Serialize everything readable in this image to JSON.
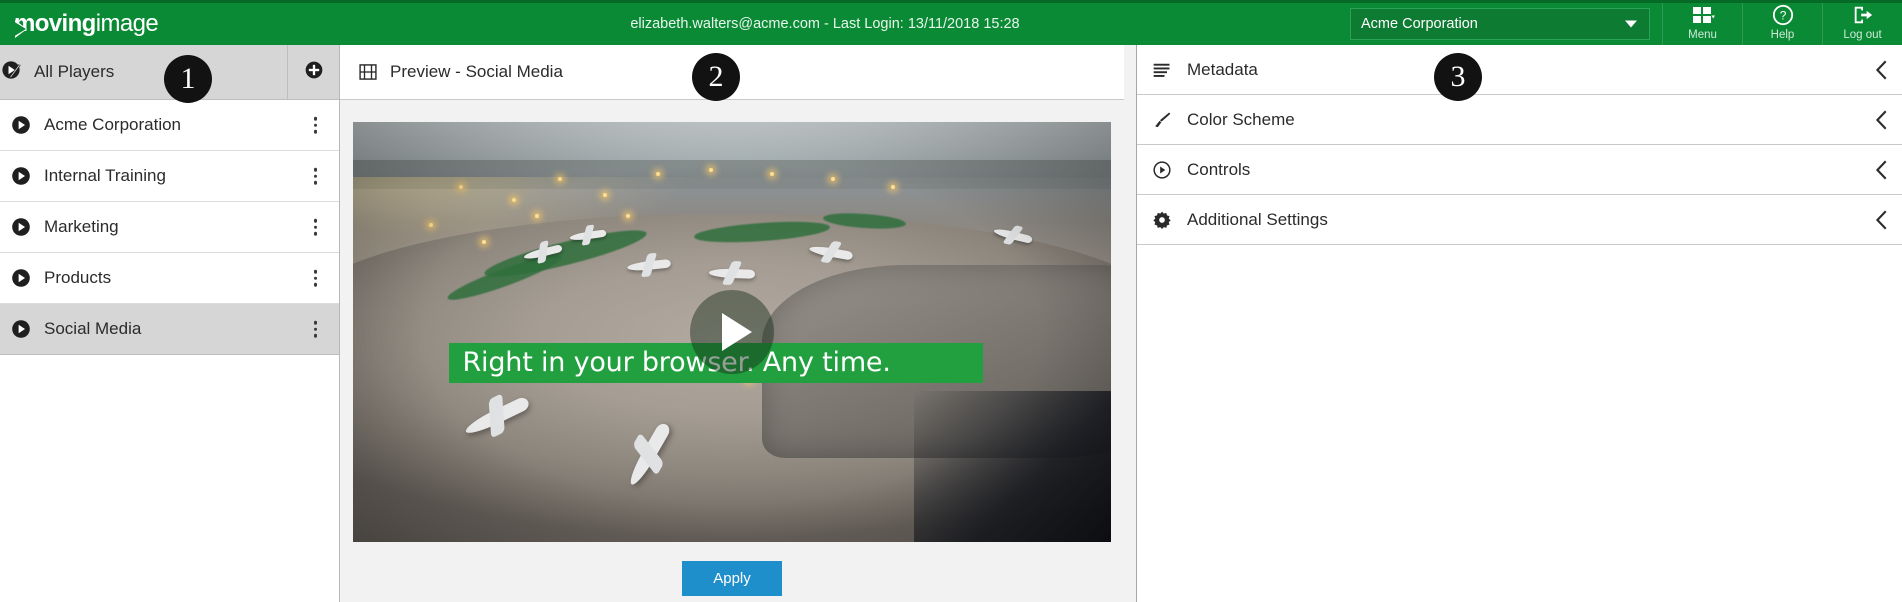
{
  "header": {
    "brand_bold": "moving",
    "brand_thin": "image",
    "session": "elizabeth.walters@acme.com - Last Login: 13/11/2018 15:28",
    "org_selected": "Acme Corporation",
    "actions": [
      {
        "label": "Menu",
        "icon": "grid-menu-icon"
      },
      {
        "label": "Help",
        "icon": "question-circle-icon"
      },
      {
        "label": "Log out",
        "icon": "logout-icon"
      }
    ],
    "colors": {
      "brand_green": "#0b8a36",
      "top_rule": "#046a26"
    }
  },
  "sidebar": {
    "header_label": "All Players",
    "header_icon": "play-check-icon",
    "add_icon": "plus-circle-icon",
    "items": [
      {
        "label": "Acme Corporation",
        "icon": "play-circle-icon",
        "selected": false
      },
      {
        "label": "Internal Training",
        "icon": "play-circle-icon",
        "selected": false
      },
      {
        "label": "Marketing",
        "icon": "play-circle-icon",
        "selected": false
      },
      {
        "label": "Products",
        "icon": "play-circle-icon",
        "selected": false
      },
      {
        "label": "Social Media",
        "icon": "play-circle-icon",
        "selected": true
      }
    ]
  },
  "center": {
    "title": "Preview - Social Media",
    "title_icon": "film-strip-icon",
    "player": {
      "caption": "Right in your browser. Any time.",
      "play_icon": "play-triangle-icon",
      "caption_bar_color": "#22a03f"
    },
    "apply_label": "Apply",
    "apply_color": "#1f8fcc"
  },
  "right_panel": {
    "items": [
      {
        "label": "Metadata",
        "icon": "list-lines-icon",
        "chevron": "chevron-left-icon"
      },
      {
        "label": "Color Scheme",
        "icon": "paintbrush-icon",
        "chevron": "chevron-left-icon"
      },
      {
        "label": "Controls",
        "icon": "play-circle-outline-icon",
        "chevron": "chevron-left-icon"
      },
      {
        "label": "Additional Settings",
        "icon": "gear-icon",
        "chevron": "chevron-left-icon"
      }
    ]
  },
  "callouts": [
    {
      "number": "1"
    },
    {
      "number": "2"
    },
    {
      "number": "3"
    }
  ]
}
